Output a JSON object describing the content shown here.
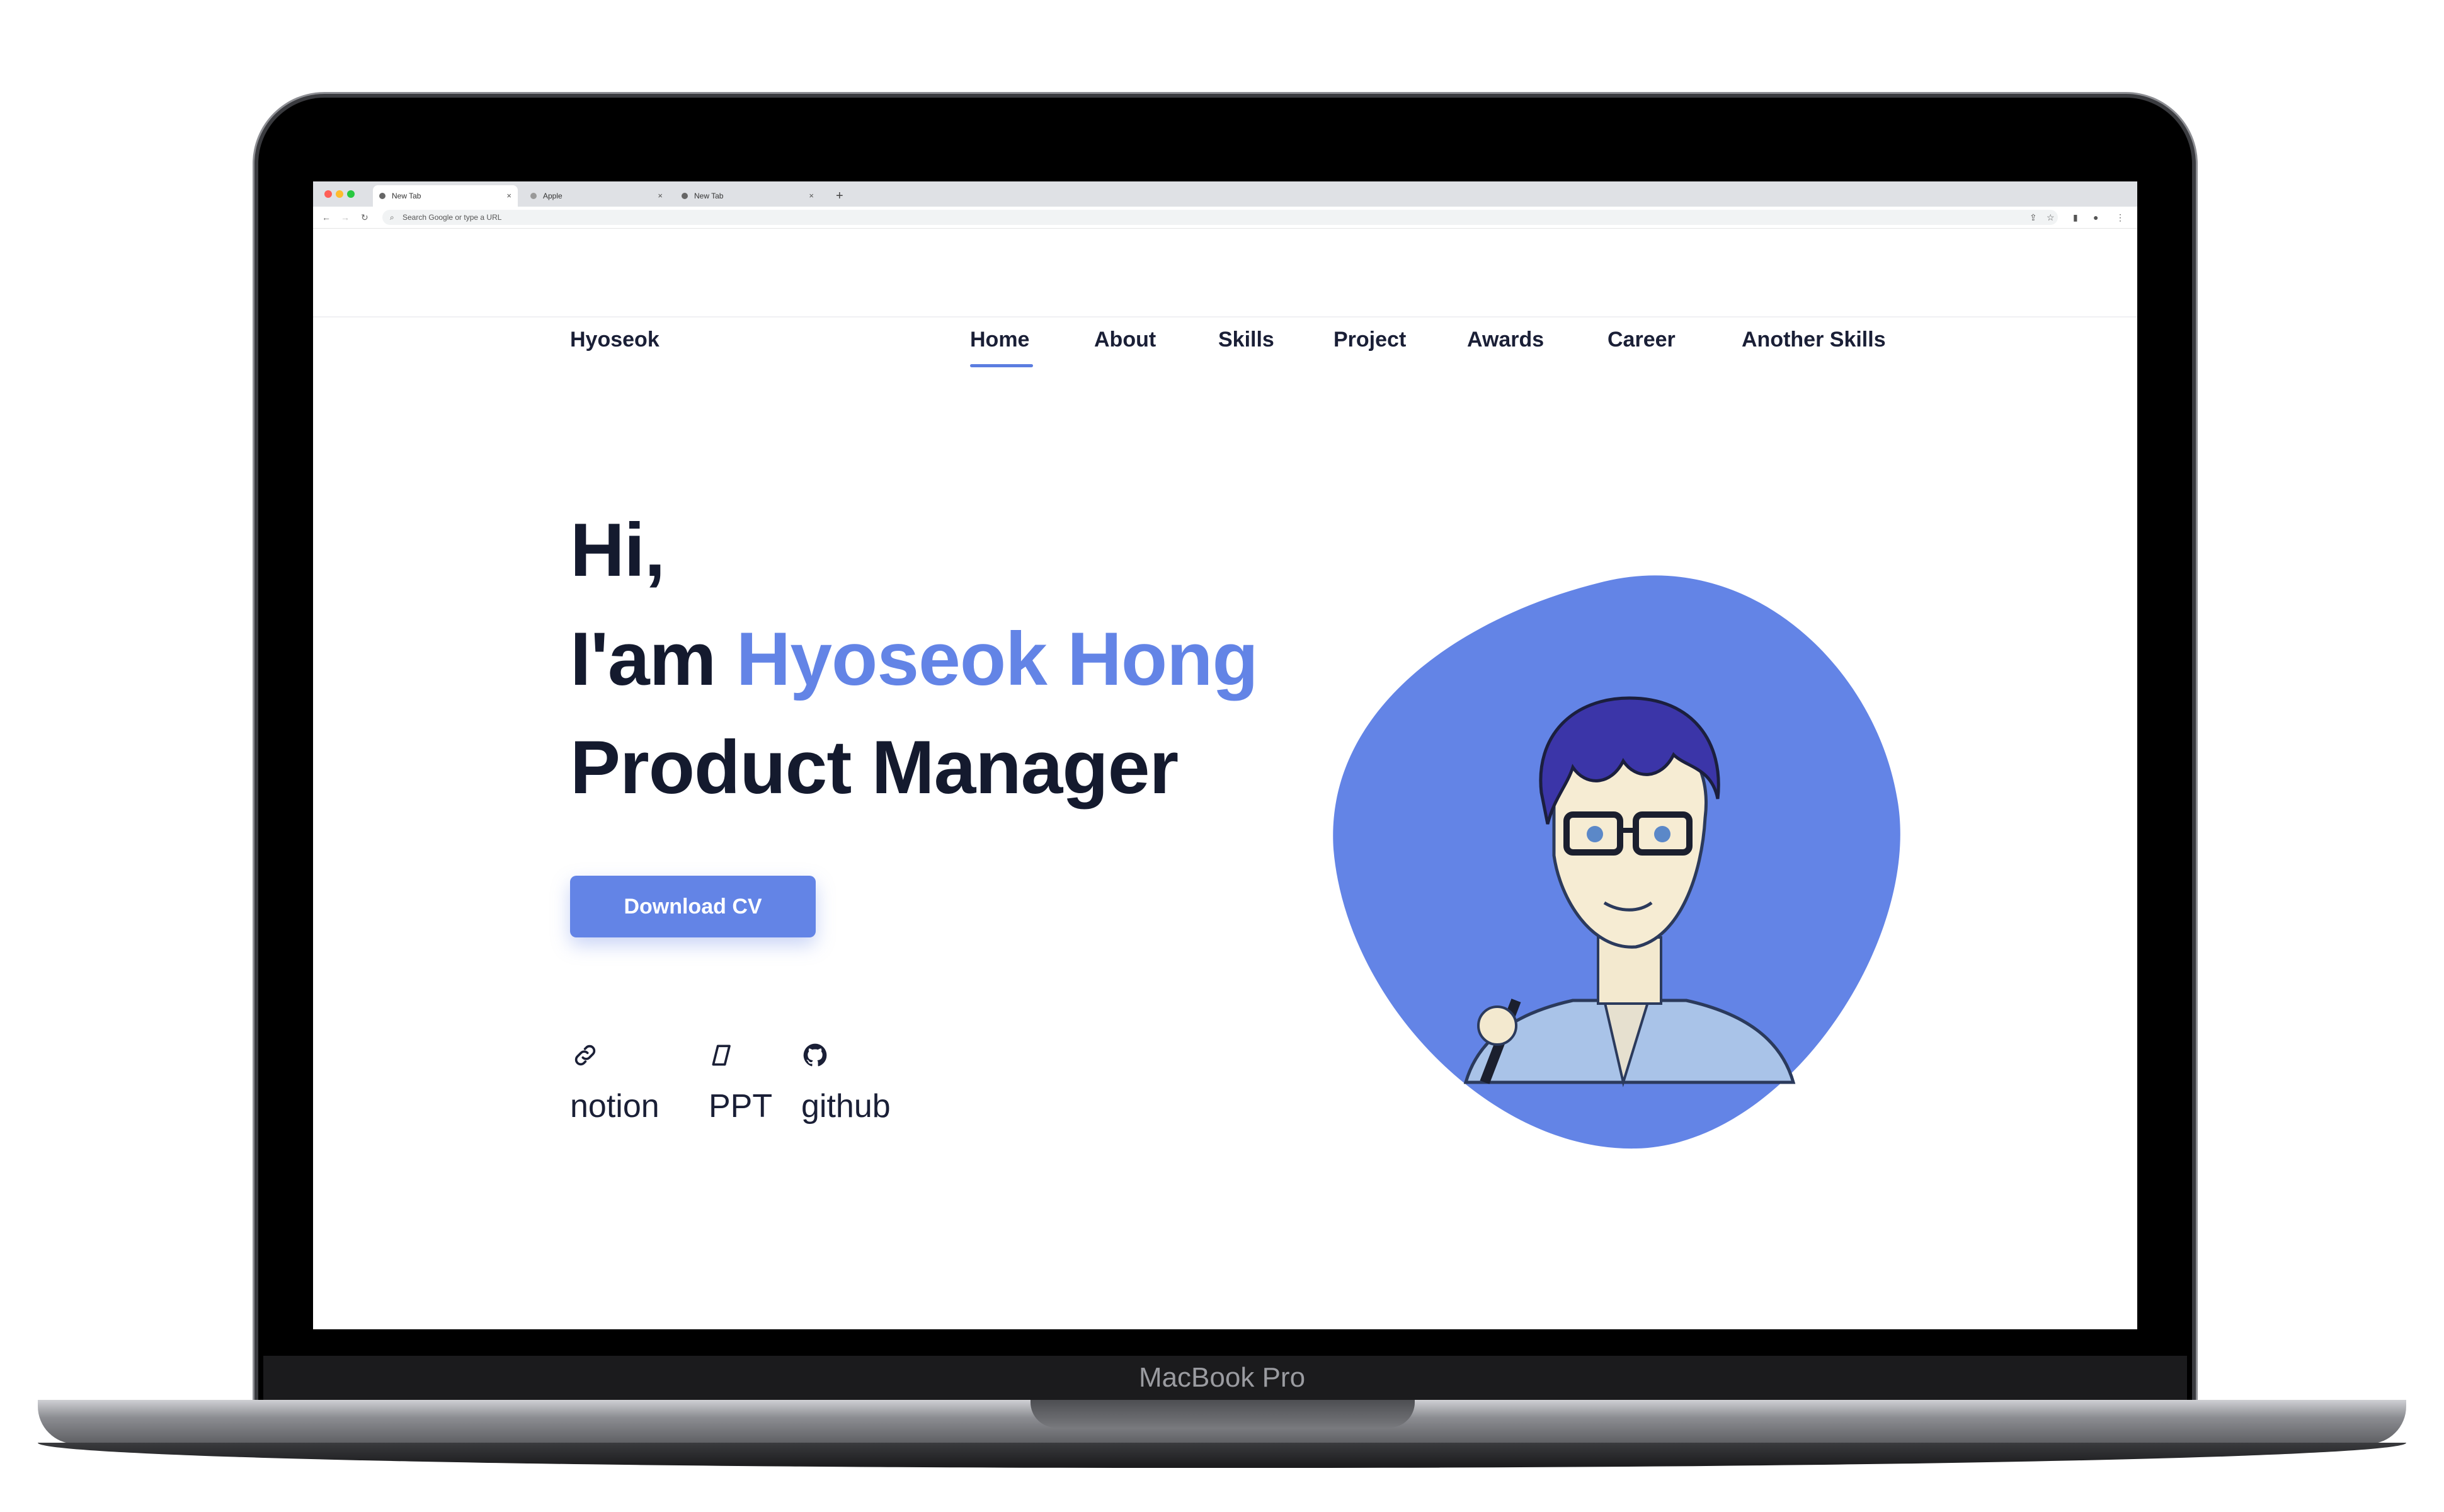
{
  "device": {
    "label": "MacBook Pro"
  },
  "browser": {
    "tabs": [
      {
        "label": "New Tab",
        "active": true
      },
      {
        "label": "Apple",
        "active": false
      },
      {
        "label": "New Tab",
        "active": false
      }
    ],
    "new_tab_symbol": "+",
    "url_placeholder": "Search Google or type a URL"
  },
  "site": {
    "brand": "Hyoseok",
    "nav": [
      "Home",
      "About",
      "Skills",
      "Project",
      "Awards",
      "Career",
      "Another Skills"
    ],
    "active_nav": "Home",
    "hero": {
      "line1": "Hi,",
      "line2_prefix": "I'am ",
      "line2_name": "Hyoseok Hong",
      "line3": "Product Manager"
    },
    "cv_button": "Download CV",
    "socials": [
      {
        "label": "notion",
        "icon": "link-icon"
      },
      {
        "label": "PPT",
        "icon": "slide-icon"
      },
      {
        "label": "github",
        "icon": "github-icon"
      }
    ]
  },
  "colors": {
    "accent": "#6384e6",
    "text": "#141a2e"
  }
}
